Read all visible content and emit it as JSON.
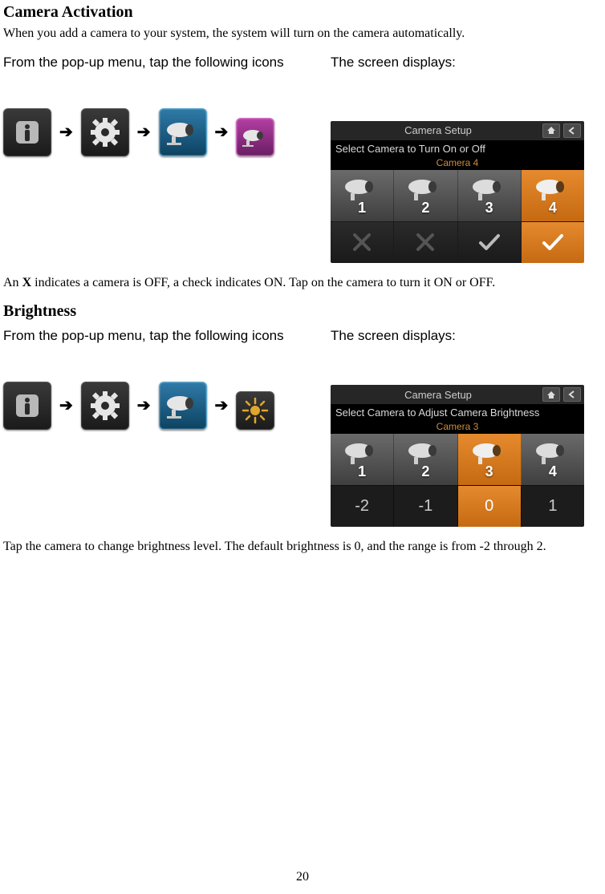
{
  "section1": {
    "title": "Camera Activation",
    "intro": "When you add a camera to your system, the system will turn on the camera automatically.",
    "left_caption": "From the pop-up menu, tap the following icons",
    "right_caption": "The screen displays:",
    "footer_pre": "An ",
    "footer_bold": "X",
    "footer_post": " indicates a camera is OFF, a check indicates ON. Tap on the camera to turn it ON or OFF."
  },
  "section2": {
    "title": "Brightness",
    "left_caption": "From the pop-up menu, tap the following icons",
    "right_caption": "The screen displays:",
    "footer": "Tap the camera to change brightness level. The default brightness is 0, and the range is from -2 through 2."
  },
  "panel_activation": {
    "title": "Camera Setup",
    "subtitle": "Select Camera to Turn On or Off",
    "selected_label": "Camera 4",
    "cameras": [
      "1",
      "2",
      "3",
      "4"
    ]
  },
  "panel_brightness": {
    "title": "Camera Setup",
    "subtitle": "Select Camera to Adjust Camera Brightness",
    "selected_label": "Camera 3",
    "cameras": [
      "1",
      "2",
      "3",
      "4"
    ],
    "values": [
      "-2",
      "-1",
      "0",
      "1"
    ]
  },
  "glyphs": {
    "arrow": "➔"
  },
  "page_number": "20"
}
